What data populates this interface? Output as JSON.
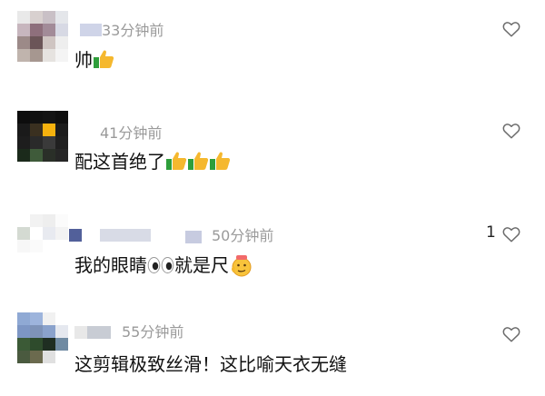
{
  "comments": [
    {
      "time": "33分钟前",
      "text": "帅",
      "emoji_count": 1,
      "emoji": "thumbs-up-icon",
      "likes": ""
    },
    {
      "time": "41分钟前",
      "text": "配这首绝了",
      "emoji_count": 3,
      "emoji": "thumbs-up-icon",
      "likes": ""
    },
    {
      "time": "50分钟前",
      "text_before": "我的眼睛",
      "text_after": "就是尺",
      "likes": "1"
    },
    {
      "time": "55分钟前",
      "text": "这剪辑极致丝滑！这比喻天衣无缝",
      "likes": ""
    }
  ],
  "icons": {
    "like": "heart-outline-icon",
    "eyes": "eyes-icon",
    "face": "thinking-face-666-icon"
  },
  "colors": {
    "meta": "#9a9a9a",
    "text": "#111111",
    "heart": "#6b6b6b",
    "thumb": "#f5b82e",
    "thumb_cuff": "#2e9e3b"
  }
}
